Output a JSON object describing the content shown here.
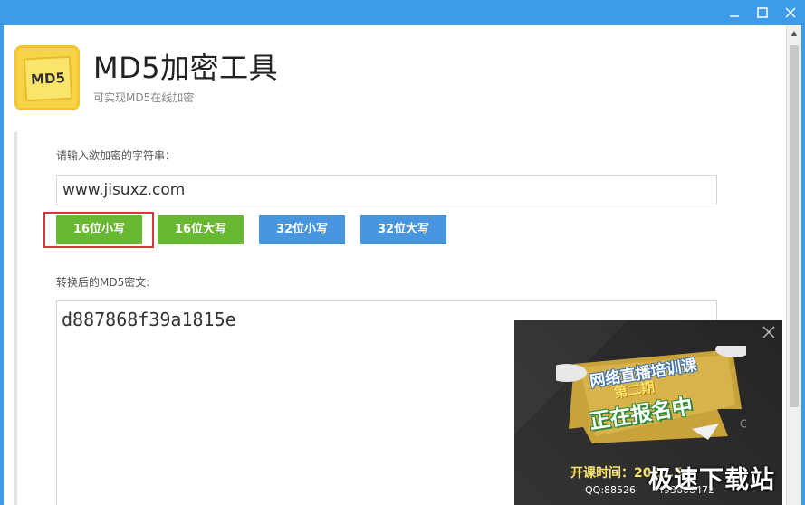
{
  "app": {
    "title": "MD5加密工具",
    "subtitle": "可实现MD5在线加密",
    "logo_text": "MD5"
  },
  "input": {
    "label": "请输入欲加密的字符串：",
    "value": "www.jisuxz.com"
  },
  "buttons": {
    "lower16": "16位小写",
    "upper16": "16位大写",
    "lower32": "32位小写",
    "upper32": "32位大写"
  },
  "output": {
    "label": "转换后的MD5密文:",
    "value": "d887868f39a1815e"
  },
  "ad": {
    "title": "网络直播培训课",
    "sub": "第二期",
    "main": "正在报名中",
    "date": "开课时间：2018.5",
    "qq": "QQ:88526",
    "qq2": "493608472"
  },
  "watermark": "极速下载站",
  "colors": {
    "titlebar": "#3d9bea",
    "green_button": "#69b833",
    "blue_button": "#4896de",
    "highlight": "#d9363a"
  }
}
